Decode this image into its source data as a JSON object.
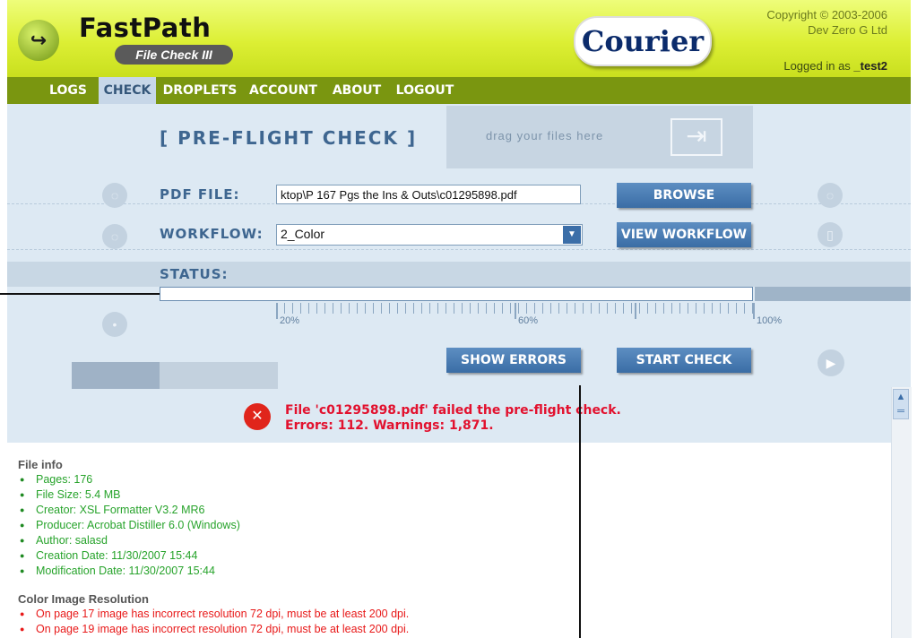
{
  "header": {
    "brand": "FastPath",
    "subtitle": "File Check III",
    "partner_logo": "Courier",
    "copyright": "Copyright © 2003-2006",
    "company": "Dev Zero G Ltd",
    "logged_in_label": "Logged in as",
    "username": "_test2"
  },
  "nav": {
    "items": [
      {
        "label": "LOGS"
      },
      {
        "label": "CHECK",
        "active": true
      },
      {
        "label": "DROPLETS"
      },
      {
        "label": "ACCOUNT"
      },
      {
        "label": "ABOUT"
      },
      {
        "label": "LOGOUT"
      }
    ]
  },
  "check": {
    "title": "[ PRE-FLIGHT CHECK ]",
    "dropzone": "drag your files here",
    "pdf_label": "PDF FILE:",
    "pdf_value": "ktop\\P 167 Pgs the Ins & Outs\\c01295898.pdf",
    "browse": "BROWSE",
    "workflow_label": "WORKFLOW:",
    "workflow_value": "2_Color",
    "view_workflow": "VIEW WORKFLOW",
    "status_label": "STATUS:",
    "progress": 0,
    "ticks": [
      "20%",
      "60%",
      "100%"
    ],
    "show_errors": "SHOW ERRORS",
    "start_check": "START CHECK",
    "error_line1": "File 'c01295898.pdf' failed the pre-flight check.",
    "error_line2": "Errors: 112. Warnings: 1,871."
  },
  "report": {
    "file_info_heading": "File info",
    "file_info": [
      "Pages: 176",
      "File Size: 5.4 MB",
      "Creator: XSL Formatter V3.2 MR6",
      "Producer: Acrobat Distiller 6.0 (Windows)",
      "Author: salasd",
      "Creation Date: 11/30/2007 15:44",
      "Modification Date: 11/30/2007 15:44"
    ],
    "color_heading": "Color Image Resolution",
    "color_errors": [
      "On page 17 image has incorrect resolution 72 dpi, must be at least 200 dpi.",
      "On page 19 image has incorrect resolution 72 dpi, must be at least 200 dpi."
    ]
  },
  "colors": {
    "header_green": "#dcef34",
    "nav_green": "#7a9610",
    "panel_blue": "#dde9f3",
    "label_blue": "#3e6690",
    "error_red": "#e2112e",
    "info_green": "#27a32b"
  }
}
